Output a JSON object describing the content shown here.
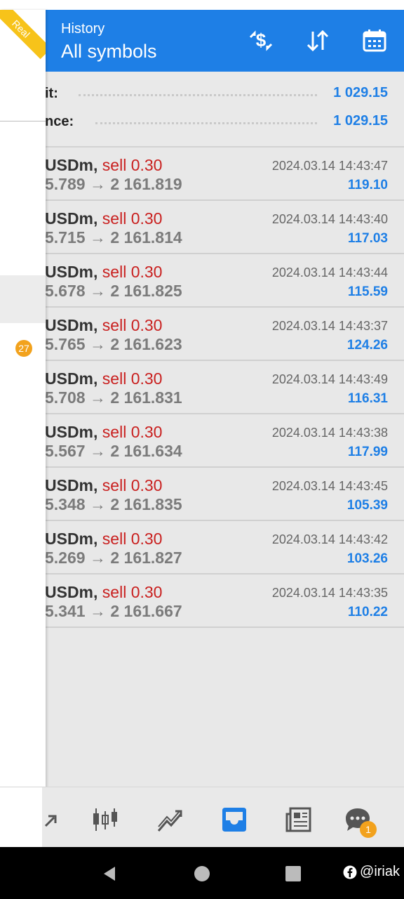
{
  "header": {
    "title_small": "History",
    "title_big": "All symbols",
    "color": "#1e7fe6"
  },
  "summary": {
    "rows": [
      {
        "label": "it:",
        "value": "1 029.15"
      },
      {
        "label": "nce:",
        "value": "1 029.15"
      }
    ]
  },
  "deals": [
    {
      "symbol": "USDm,",
      "side": "sell 0.30",
      "open": "5.789",
      "close": "2 161.819",
      "time": "2024.03.14 14:43:47",
      "profit": "119.10"
    },
    {
      "symbol": "USDm,",
      "side": "sell 0.30",
      "open": "5.715",
      "close": "2 161.814",
      "time": "2024.03.14 14:43:40",
      "profit": "117.03"
    },
    {
      "symbol": "USDm,",
      "side": "sell 0.30",
      "open": "5.678",
      "close": "2 161.825",
      "time": "2024.03.14 14:43:44",
      "profit": "115.59"
    },
    {
      "symbol": "USDm,",
      "side": "sell 0.30",
      "open": "5.765",
      "close": "2 161.623",
      "time": "2024.03.14 14:43:37",
      "profit": "124.26"
    },
    {
      "symbol": "USDm,",
      "side": "sell 0.30",
      "open": "5.708",
      "close": "2 161.831",
      "time": "2024.03.14 14:43:49",
      "profit": "116.31"
    },
    {
      "symbol": "USDm,",
      "side": "sell 0.30",
      "open": "5.567",
      "close": "2 161.634",
      "time": "2024.03.14 14:43:38",
      "profit": "117.99"
    },
    {
      "symbol": "USDm,",
      "side": "sell 0.30",
      "open": "5.348",
      "close": "2 161.835",
      "time": "2024.03.14 14:43:45",
      "profit": "105.39"
    },
    {
      "symbol": "USDm,",
      "side": "sell 0.30",
      "open": "5.269",
      "close": "2 161.827",
      "time": "2024.03.14 14:43:42",
      "profit": "103.26"
    },
    {
      "symbol": "USDm,",
      "side": "sell 0.30",
      "open": "5.341",
      "close": "2 161.667",
      "time": "2024.03.14 14:43:35",
      "profit": "110.22"
    }
  ],
  "drawer": {
    "ribbon": "Real",
    "badge": "27"
  },
  "bottom_nav": {
    "items": [
      "trade-icon",
      "chart-icon",
      "trend-icon",
      "history-inbox-icon",
      "news-icon",
      "chat-icon"
    ],
    "active": "history-inbox-icon",
    "chat_badge": "1"
  },
  "watermark": {
    "text": "@iriak"
  }
}
